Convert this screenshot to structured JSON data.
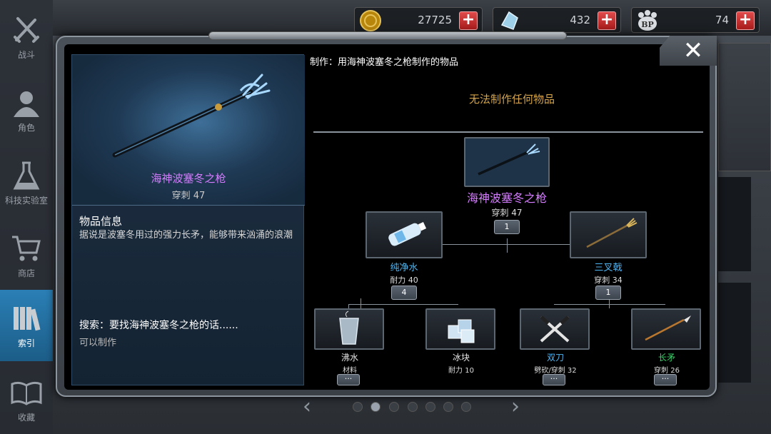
{
  "sidebar": {
    "items": [
      {
        "label": "战斗",
        "icon": "swords-icon"
      },
      {
        "label": "角色",
        "icon": "character-icon"
      },
      {
        "label": "科技实验室",
        "icon": "flask-icon"
      },
      {
        "label": "商店",
        "icon": "cart-icon"
      },
      {
        "label": "索引",
        "icon": "books-icon",
        "active": true
      },
      {
        "label": "收藏",
        "icon": "open-book-icon"
      }
    ]
  },
  "currency": {
    "coins": "27725",
    "crystals": "432",
    "bp": "74",
    "bp_icon_label": "BP"
  },
  "dialog": {
    "close": "✕",
    "item": {
      "name": "海神波塞冬之枪",
      "stat": "穿刺 47",
      "info_title": "物品信息",
      "info_text": "据说是波塞冬用过的强力长矛，能够带来汹涌的浪潮",
      "search_title": "搜索：要找海神波塞冬之枪的话......",
      "search_text": "可以制作"
    },
    "craft": {
      "header": "制作：用海神波塞冬之枪制作的物品",
      "empty": "无法制作任何物品"
    },
    "tree": {
      "root": {
        "name": "海神波塞冬之枪",
        "stat": "穿刺 47",
        "count": "1"
      },
      "level1": [
        {
          "name": "纯净水",
          "stat": "耐力 40",
          "count": "4",
          "color": "#4fb6f2"
        },
        {
          "name": "三叉戟",
          "stat": "穿刺 34",
          "count": "1",
          "color": "#4fb6f2"
        }
      ],
      "level2": [
        {
          "name": "沸水",
          "stat": "材料",
          "more": "···",
          "color": "#e6e6e6"
        },
        {
          "name": "冰块",
          "stat": "耐力 10",
          "more": null,
          "color": "#e6e6e6"
        },
        {
          "name": "双刀",
          "stat": "劈砍/穿刺 32",
          "more": "···",
          "color": "#4fb6f2"
        },
        {
          "name": "长矛",
          "stat": "穿刺 26",
          "more": "···",
          "color": "#39d36a"
        }
      ]
    }
  },
  "pagination": {
    "prev": "‹",
    "next": "›",
    "pages": 7,
    "current": 2
  },
  "colors": {
    "accent": "#2a7fb5",
    "purple": "#d57cff",
    "gold": "#d3a44c",
    "blue": "#4fb6f2",
    "green": "#39d36a"
  }
}
